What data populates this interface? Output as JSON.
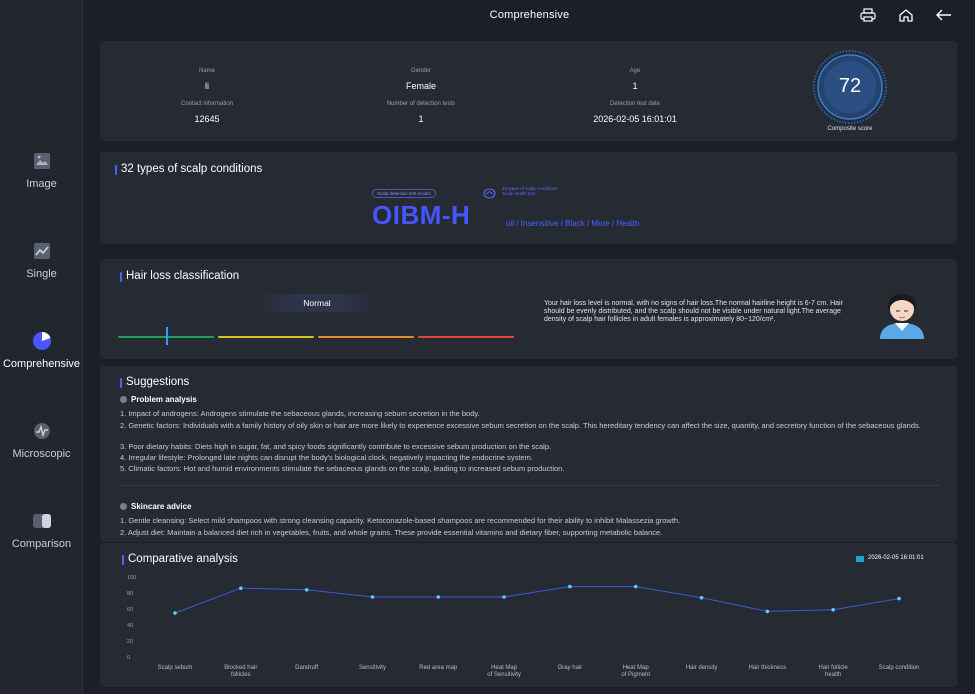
{
  "header": {
    "title": "Comprehensive"
  },
  "sidebar": {
    "items": [
      {
        "label": "Image"
      },
      {
        "label": "Single"
      },
      {
        "label": "Comprehensive"
      },
      {
        "label": "Microscopic"
      },
      {
        "label": "Comparison"
      }
    ]
  },
  "profile": {
    "name_label": "Name",
    "name": "li",
    "gender_label": "Gender",
    "gender": "Female",
    "age_label": "Age",
    "age": "1",
    "contact_label": "Contact information",
    "contact": "12645",
    "tests_label": "Number of detection tests",
    "tests": "1",
    "date_label": "Detection test date",
    "date": "2026-02-05 16:01:01",
    "score": "72",
    "score_label": "Composite score"
  },
  "scalp": {
    "title": "32 types of scalp conditions",
    "pill": "Scalp detection test results",
    "mini_line1": "32 types of scalp conditions",
    "mini_line2": "Scalp health test",
    "code": "OIBM-H",
    "conditions": "oil / Insensitive / Black / More / Health"
  },
  "hairloss": {
    "title": "Hair loss classification",
    "level": "Normal",
    "level_fraction": 0.12,
    "description": "Your hair loss level is normal, with no signs of hair loss.The normal hairline height is 6-7 cm. Hair should be evenly distributed, and the scalp should not be visible under natural light.The average density of scalp hair follicles in adult females is approximately 80~120/cm².",
    "bar_colors": [
      "#1fa05a",
      "#d6c21d",
      "#e8892a",
      "#e0473b"
    ]
  },
  "suggestions": {
    "title": "Suggestions",
    "problem_title": "Problem analysis",
    "problem_items": [
      "1. Impact of androgens: Androgens stimulate the sebaceous glands, increasing sebum secretion in the body.",
      "2. Genetic factors: Individuals with a family history of oily skin or hair are more likely to experience excessive sebum secretion on the scalp.  This hereditary tendency can affect the size, quantity, and secretory function of the sebaceous glands.",
      "3. Poor dietary habits: Diets high in sugar, fat, and spicy foods significantly contribute to excessive sebum production on the scalp.",
      "4. Irregular lifestyle: Prolonged late nights can disrupt the body's biological clock, negatively impacting the endocrine system.",
      "5. Climatic factors: Hot and humid environments stimulate the sebaceous glands on the scalp, leading to increased sebum production."
    ],
    "advice_title": "Skincare advice",
    "advice_items": [
      "1. Gentle cleansing: Select mild shampoos with strong cleansing capacity. Ketoconazole-based shampoos are recommended for their ability to inhibit Malassezia growth.",
      "2. Adjust diet: Maintain a balanced diet rich in vegetables, fruits, and whole grains. These provide essential vitamins and dietary fiber, supporting metabolic balance."
    ]
  },
  "chart_data": {
    "type": "line",
    "title": "Comparative analysis",
    "categories": [
      "Scalp sebum",
      "Blocked hair follicles",
      "Dandruff",
      "Sensitivity",
      "Red area map",
      "Heat Map of Sensitivity",
      "Gray hair",
      "Heat Map of Pigment",
      "Hair density",
      "Hair thickness",
      "Hair follicle health",
      "Scalp condition"
    ],
    "series": [
      {
        "name": "2026-02-05 16:01:01",
        "values": [
          55,
          86,
          84,
          75,
          75,
          75,
          88,
          88,
          74,
          57,
          59,
          73
        ],
        "color": "#21a6c9"
      }
    ],
    "y_ticks": [
      "100",
      "80",
      "60",
      "40",
      "20",
      "0"
    ],
    "ylim": [
      0,
      100
    ],
    "grid": false,
    "legend": "top-right"
  }
}
